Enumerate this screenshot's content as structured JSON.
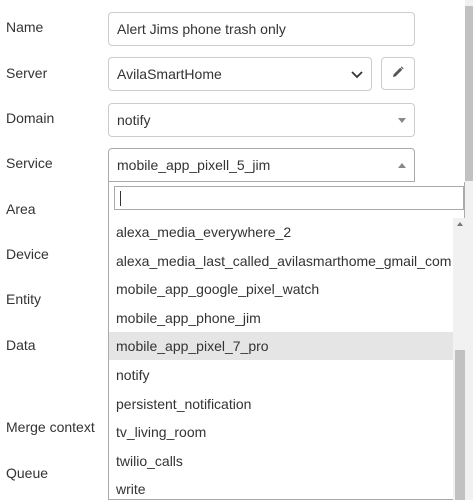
{
  "form": {
    "labels": {
      "name": "Name",
      "server": "Server",
      "domain": "Domain",
      "service": "Service",
      "area": "Area",
      "device": "Device",
      "entity": "Entity",
      "data": "Data",
      "merge_context": "Merge context",
      "queue": "Queue"
    },
    "name_value": "Alert Jims phone trash only",
    "server_value": "AvilaSmartHome",
    "domain_value": "notify",
    "service_value": "mobile_app_pixell_5_jim"
  },
  "dropdown": {
    "search_value": "",
    "options": [
      "alexa_media_everywhere_2",
      "alexa_media_last_called_avilasmarthome_gmail_com",
      "mobile_app_google_pixel_watch",
      "mobile_app_phone_jim",
      "mobile_app_pixel_7_pro",
      "notify",
      "persistent_notification",
      "tv_living_room",
      "twilio_calls",
      "write"
    ],
    "highlighted_option": "mobile_app_pixel_7_pro"
  },
  "icons": {
    "edit": "pencil-icon",
    "select_arrow": "chevron-down-icon",
    "combo_open": "caret-up-icon",
    "combo_closed": "caret-down-icon"
  },
  "colors": {
    "highlight": "#e5e5e5",
    "border": "#cccccc"
  }
}
